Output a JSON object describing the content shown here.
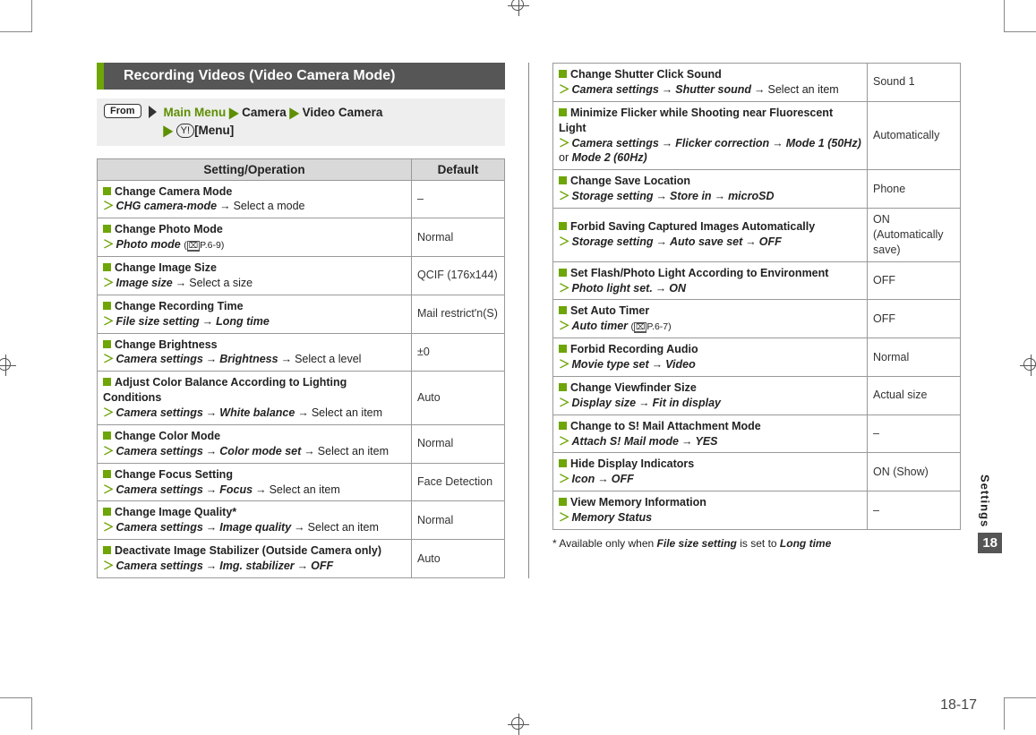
{
  "title": "Recording Videos (Video Camera Mode)",
  "from_label": "From",
  "nav": {
    "main_menu": "Main Menu",
    "camera": "Camera",
    "video_camera": "Video Camera",
    "softkey": "Y!",
    "menu_label": "[Menu]"
  },
  "header": {
    "setting": "Setting/Operation",
    "default": "Default"
  },
  "rows_left": [
    {
      "title": "Change Camera Mode",
      "path": [
        {
          "em": "CHG camera-mode"
        },
        {
          "arr": true
        },
        {
          "txt": "Select a mode"
        }
      ],
      "def": "–"
    },
    {
      "title": "Change Photo Mode",
      "path": [
        {
          "em": "Photo mode"
        },
        {
          "ref": "P.6-9"
        }
      ],
      "def": "Normal"
    },
    {
      "title": "Change Image Size",
      "path": [
        {
          "em": "Image size"
        },
        {
          "arr": true
        },
        {
          "txt": "Select a size"
        }
      ],
      "def": "QCIF (176x144)"
    },
    {
      "title": "Change Recording Time",
      "path": [
        {
          "em": "File size setting"
        },
        {
          "arr": true
        },
        {
          "em": "Long time"
        }
      ],
      "def": "Mail restrict'n(S)"
    },
    {
      "title": "Change Brightness",
      "path": [
        {
          "em": "Camera settings"
        },
        {
          "arr": true
        },
        {
          "em": "Brightness"
        },
        {
          "arr": true
        },
        {
          "txt": "Select a level"
        }
      ],
      "def": "±0"
    },
    {
      "title": "Adjust Color Balance According to Lighting Conditions",
      "path": [
        {
          "em": "Camera settings"
        },
        {
          "arr": true
        },
        {
          "em": "White balance"
        },
        {
          "arr": true
        },
        {
          "txt": "Select an item"
        }
      ],
      "def": "Auto"
    },
    {
      "title": "Change Color Mode",
      "path": [
        {
          "em": "Camera settings"
        },
        {
          "arr": true
        },
        {
          "em": "Color mode set"
        },
        {
          "arr": true
        },
        {
          "txt": "Select an item"
        }
      ],
      "def": "Normal"
    },
    {
      "title": "Change Focus Setting",
      "path": [
        {
          "em": "Camera settings"
        },
        {
          "arr": true
        },
        {
          "em": "Focus"
        },
        {
          "arr": true
        },
        {
          "txt": "Select an item"
        }
      ],
      "def": "Face Detection"
    },
    {
      "title": "Change Image Quality*",
      "path": [
        {
          "em": "Camera settings"
        },
        {
          "arr": true
        },
        {
          "em": "Image quality"
        },
        {
          "arr": true
        },
        {
          "txt": "Select an item"
        }
      ],
      "def": "Normal"
    },
    {
      "title": "Deactivate Image Stabilizer (Outside Camera only)",
      "path": [
        {
          "em": "Camera settings"
        },
        {
          "arr": true
        },
        {
          "em": "Img. stabilizer"
        },
        {
          "arr": true
        },
        {
          "em": "OFF"
        }
      ],
      "def": "Auto"
    }
  ],
  "rows_right": [
    {
      "title": "Change Shutter Click Sound",
      "path": [
        {
          "em": "Camera settings"
        },
        {
          "arr": true
        },
        {
          "em": "Shutter sound"
        },
        {
          "arr": true
        },
        {
          "txt": "Select an item"
        }
      ],
      "def": "Sound 1"
    },
    {
      "title": "Minimize Flicker while Shooting near Fluorescent Light",
      "path": [
        {
          "em": "Camera settings"
        },
        {
          "arr": true
        },
        {
          "em": "Flicker correction"
        },
        {
          "arr": true
        },
        {
          "em": "Mode 1 (50Hz)"
        },
        {
          "txt": " or "
        },
        {
          "em": "Mode 2 (60Hz)"
        }
      ],
      "def": "Automatically"
    },
    {
      "title": "Change Save Location",
      "path": [
        {
          "em": "Storage setting"
        },
        {
          "arr": true
        },
        {
          "em": "Store in"
        },
        {
          "arr": true
        },
        {
          "em": "microSD"
        }
      ],
      "def": "Phone"
    },
    {
      "title": "Forbid Saving Captured Images Automatically",
      "path": [
        {
          "em": "Storage setting"
        },
        {
          "arr": true
        },
        {
          "em": "Auto save set"
        },
        {
          "arr": true
        },
        {
          "em": "OFF"
        }
      ],
      "def": "ON (Automatically save)"
    },
    {
      "title": "Set Flash/Photo Light According to Environment",
      "path": [
        {
          "em": "Photo light set."
        },
        {
          "arr": true
        },
        {
          "em": "ON"
        }
      ],
      "def": "OFF"
    },
    {
      "title": "Set Auto Timer",
      "path": [
        {
          "em": "Auto timer"
        },
        {
          "ref": "P.6-7"
        }
      ],
      "def": "OFF"
    },
    {
      "title": "Forbid Recording Audio",
      "path": [
        {
          "em": "Movie type set"
        },
        {
          "arr": true
        },
        {
          "em": "Video"
        }
      ],
      "def": "Normal"
    },
    {
      "title": "Change Viewfinder Size",
      "path": [
        {
          "em": "Display size"
        },
        {
          "arr": true
        },
        {
          "em": "Fit in display"
        }
      ],
      "def": "Actual size"
    },
    {
      "title": "Change to S! Mail Attachment Mode",
      "path": [
        {
          "em": "Attach S! Mail mode"
        },
        {
          "arr": true
        },
        {
          "em": "YES"
        }
      ],
      "def": "–"
    },
    {
      "title": "Hide Display Indicators",
      "path": [
        {
          "em": "Icon"
        },
        {
          "arr": true
        },
        {
          "em": "OFF"
        }
      ],
      "def": "ON (Show)"
    },
    {
      "title": "View Memory Information",
      "path": [
        {
          "em": "Memory Status"
        }
      ],
      "def": "–"
    }
  ],
  "footnote_prefix": "* Available only when ",
  "footnote_em1": "File size setting",
  "footnote_mid": " is set to ",
  "footnote_em2": "Long time",
  "side": {
    "label": "Settings",
    "chapter": "18"
  },
  "page_number": "18-17"
}
